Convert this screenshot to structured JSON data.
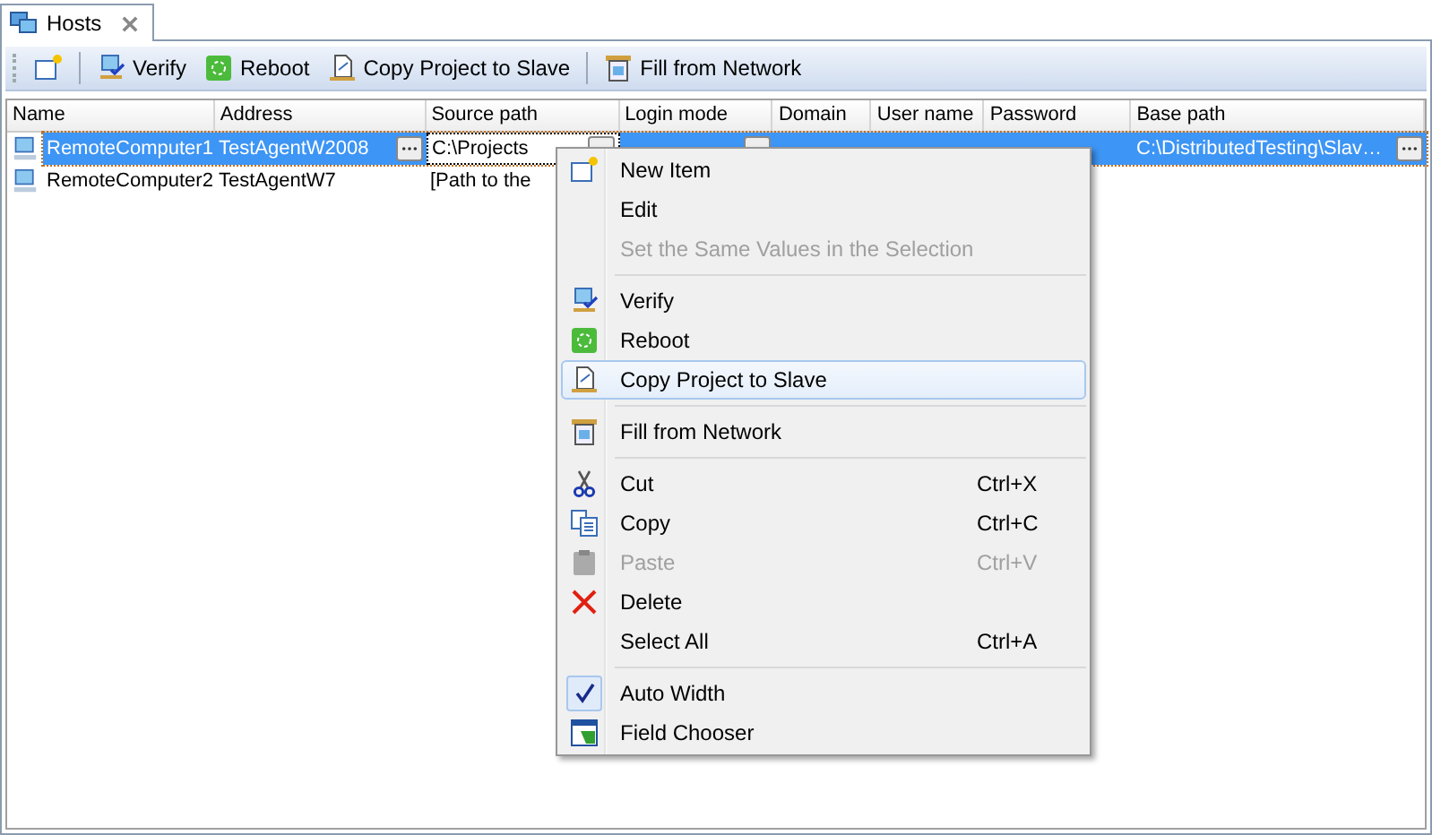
{
  "tab": {
    "label": "Hosts"
  },
  "toolbar": [
    {
      "kind": "new"
    },
    {
      "kind": "sep"
    },
    {
      "kind": "verify",
      "label": "Verify"
    },
    {
      "kind": "reboot",
      "label": "Reboot"
    },
    {
      "kind": "copy",
      "label": "Copy Project to Slave"
    },
    {
      "kind": "sep"
    },
    {
      "kind": "fill",
      "label": "Fill from Network"
    }
  ],
  "table": {
    "columns": [
      "Name",
      "Address",
      "Source path",
      "Login mode",
      "Domain",
      "User name",
      "Password",
      "Base path"
    ],
    "rows": [
      {
        "selected": true,
        "cells": [
          {
            "text": "RemoteComputer1"
          },
          {
            "text": "TestAgentW2008",
            "button": true
          },
          {
            "text": "C:\\Projects",
            "button": true,
            "editing": true
          },
          {
            "button": true
          },
          {},
          {},
          {},
          {
            "text": "C:\\DistributedTesting\\Slav…",
            "button": true
          }
        ]
      },
      {
        "selected": false,
        "cells": [
          {
            "text": "RemoteComputer2"
          },
          {
            "text": "TestAgentW7"
          },
          {
            "text": "[Path to the"
          }
        ]
      }
    ]
  },
  "context_menu": [
    {
      "kind": "item",
      "label": "New Item",
      "disabled": false,
      "selected": false
    },
    {
      "kind": "item",
      "label": "Edit",
      "disabled": false,
      "selected": false
    },
    {
      "kind": "item",
      "label": "Set the Same Values in the Selection",
      "disabled": true,
      "selected": false
    },
    {
      "kind": "separator"
    },
    {
      "kind": "item",
      "label": "Verify",
      "disabled": false,
      "selected": false
    },
    {
      "kind": "item",
      "label": "Reboot",
      "disabled": false,
      "selected": false
    },
    {
      "kind": "item",
      "label": "Copy Project to Slave",
      "disabled": false,
      "selected": true
    },
    {
      "kind": "separator"
    },
    {
      "kind": "item",
      "label": "Fill from Network",
      "disabled": false,
      "selected": false
    },
    {
      "kind": "separator"
    },
    {
      "kind": "item",
      "label": "Cut",
      "shortcut": "Ctrl+X",
      "disabled": false,
      "selected": false
    },
    {
      "kind": "item",
      "label": "Copy",
      "shortcut": "Ctrl+C",
      "disabled": false,
      "selected": false
    },
    {
      "kind": "item",
      "label": "Paste",
      "shortcut": "Ctrl+V",
      "disabled": true,
      "selected": false
    },
    {
      "kind": "item",
      "label": "Delete",
      "disabled": false,
      "selected": false
    },
    {
      "kind": "item",
      "label": "Select All",
      "shortcut": "Ctrl+A",
      "disabled": false,
      "selected": false
    },
    {
      "kind": "separator"
    },
    {
      "kind": "item",
      "label": "Auto Width",
      "disabled": false,
      "selected": false,
      "checked": true
    },
    {
      "kind": "item",
      "label": "Field Chooser",
      "disabled": false,
      "selected": false
    }
  ]
}
